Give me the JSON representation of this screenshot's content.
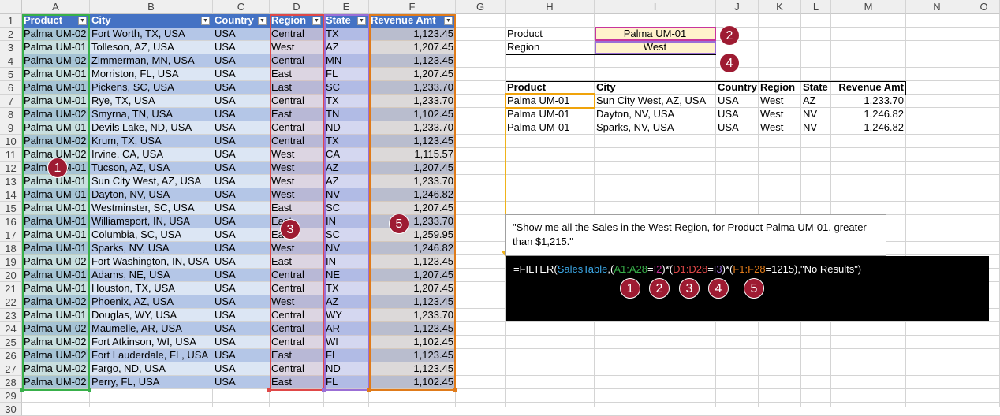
{
  "columns": [
    "A",
    "B",
    "C",
    "D",
    "E",
    "F",
    "G",
    "H",
    "I",
    "J",
    "K",
    "L",
    "M",
    "N",
    "O"
  ],
  "table": {
    "name": "SalesTable",
    "headers": [
      "Product",
      "City",
      "Country",
      "Region",
      "State",
      "Revenue Amt"
    ],
    "rows": [
      [
        "Palma UM-02",
        "Fort Worth, TX, USA",
        "USA",
        "Central",
        "TX",
        "1,123.45"
      ],
      [
        "Palma UM-01",
        "Tolleson, AZ, USA",
        "USA",
        "West",
        "AZ",
        "1,207.45"
      ],
      [
        "Palma UM-02",
        "Zimmerman, MN, USA",
        "USA",
        "Central",
        "MN",
        "1,123.45"
      ],
      [
        "Palma UM-01",
        "Morriston, FL, USA",
        "USA",
        "East",
        "FL",
        "1,207.45"
      ],
      [
        "Palma UM-01",
        "Pickens, SC, USA",
        "USA",
        "East",
        "SC",
        "1,233.70"
      ],
      [
        "Palma UM-01",
        "Rye, TX, USA",
        "USA",
        "Central",
        "TX",
        "1,233.70"
      ],
      [
        "Palma UM-02",
        "Smyrna, TN, USA",
        "USA",
        "East",
        "TN",
        "1,102.45"
      ],
      [
        "Palma UM-01",
        "Devils Lake, ND, USA",
        "USA",
        "Central",
        "ND",
        "1,233.70"
      ],
      [
        "Palma UM-02",
        "Krum, TX, USA",
        "USA",
        "Central",
        "TX",
        "1,123.45"
      ],
      [
        "Palma UM-02",
        "Irvine, CA, USA",
        "USA",
        "West",
        "CA",
        "1,115.57"
      ],
      [
        "Palma UM-01",
        "Tucson, AZ, USA",
        "USA",
        "West",
        "AZ",
        "1,207.45"
      ],
      [
        "Palma UM-01",
        "Sun City West, AZ, USA",
        "USA",
        "West",
        "AZ",
        "1,233.70"
      ],
      [
        "Palma UM-01",
        "Dayton, NV, USA",
        "USA",
        "West",
        "NV",
        "1,246.82"
      ],
      [
        "Palma UM-01",
        "Westminster, SC, USA",
        "USA",
        "East",
        "SC",
        "1,207.45"
      ],
      [
        "Palma UM-01",
        "Williamsport, IN, USA",
        "USA",
        "East",
        "IN",
        "1,233.70"
      ],
      [
        "Palma UM-01",
        "Columbia, SC, USA",
        "USA",
        "East",
        "SC",
        "1,259.95"
      ],
      [
        "Palma UM-01",
        "Sparks, NV, USA",
        "USA",
        "West",
        "NV",
        "1,246.82"
      ],
      [
        "Palma UM-02",
        "Fort Washington, IN, USA",
        "USA",
        "East",
        "IN",
        "1,123.45"
      ],
      [
        "Palma UM-01",
        "Adams, NE, USA",
        "USA",
        "Central",
        "NE",
        "1,207.45"
      ],
      [
        "Palma UM-01",
        "Houston, TX, USA",
        "USA",
        "Central",
        "TX",
        "1,207.45"
      ],
      [
        "Palma UM-02",
        "Phoenix, AZ, USA",
        "USA",
        "West",
        "AZ",
        "1,123.45"
      ],
      [
        "Palma UM-01",
        "Douglas, WY, USA",
        "USA",
        "Central",
        "WY",
        "1,233.70"
      ],
      [
        "Palma UM-02",
        "Maumelle, AR, USA",
        "USA",
        "Central",
        "AR",
        "1,123.45"
      ],
      [
        "Palma UM-02",
        "Fort Atkinson, WI, USA",
        "USA",
        "Central",
        "WI",
        "1,102.45"
      ],
      [
        "Palma UM-02",
        "Fort Lauderdale, FL, USA",
        "USA",
        "East",
        "FL",
        "1,123.45"
      ],
      [
        "Palma UM-02",
        "Fargo, ND, USA",
        "USA",
        "Central",
        "ND",
        "1,123.45"
      ],
      [
        "Palma UM-02",
        "Perry, FL, USA",
        "USA",
        "East",
        "FL",
        "1,102.45"
      ]
    ]
  },
  "criteria": {
    "product_label": "Product",
    "product_value": "Palma UM-01",
    "region_label": "Region",
    "region_value": "West"
  },
  "results": {
    "headers": [
      "Product",
      "City",
      "Country",
      "Region",
      "State",
      "Revenue Amt"
    ],
    "rows": [
      [
        "Palma UM-01",
        "Sun City West, AZ, USA",
        "USA",
        "West",
        "AZ",
        "1,233.70"
      ],
      [
        "Palma UM-01",
        "Dayton, NV, USA",
        "USA",
        "West",
        "NV",
        "1,246.82"
      ],
      [
        "Palma UM-01",
        "Sparks, NV, USA",
        "USA",
        "West",
        "NV",
        "1,246.82"
      ]
    ]
  },
  "note": "\"Show me all the Sales in the West Region, for Product Palma UM-01, greater than $1,215.\"",
  "formula": {
    "parts": [
      {
        "text": "=FILTER(",
        "color": "#ffffff"
      },
      {
        "text": "SalesTable",
        "color": "#3da9e8"
      },
      {
        "text": ",(",
        "color": "#ffffff"
      },
      {
        "text": "A1:A28",
        "color": "#38b04a"
      },
      {
        "text": "=",
        "color": "#ffffff"
      },
      {
        "text": "I2",
        "color": "#c7359c"
      },
      {
        "text": ")*(",
        "color": "#ffffff"
      },
      {
        "text": "D1:D28",
        "color": "#e04848"
      },
      {
        "text": "=",
        "color": "#ffffff"
      },
      {
        "text": "I3",
        "color": "#9b6fd6"
      },
      {
        "text": ")*(",
        "color": "#ffffff"
      },
      {
        "text": "F1:F28",
        "color": "#e07b1a"
      },
      {
        "text": "=1215),\"No Results\")",
        "color": "#ffffff"
      }
    ]
  },
  "callouts": [
    "1",
    "2",
    "3",
    "4",
    "5"
  ],
  "colors": {
    "header_bg": "#4472c4",
    "band_dark": "#b4c6e7",
    "band_light": "#dce6f4",
    "criteria_fill": "#fff2cc",
    "callout_fill": "#9e1b32",
    "range_a": "#38b04a",
    "range_d": "#e04848",
    "range_e": "#9b6fd6",
    "range_f": "#e07b1a",
    "result_highlight": "#f0a30a"
  }
}
